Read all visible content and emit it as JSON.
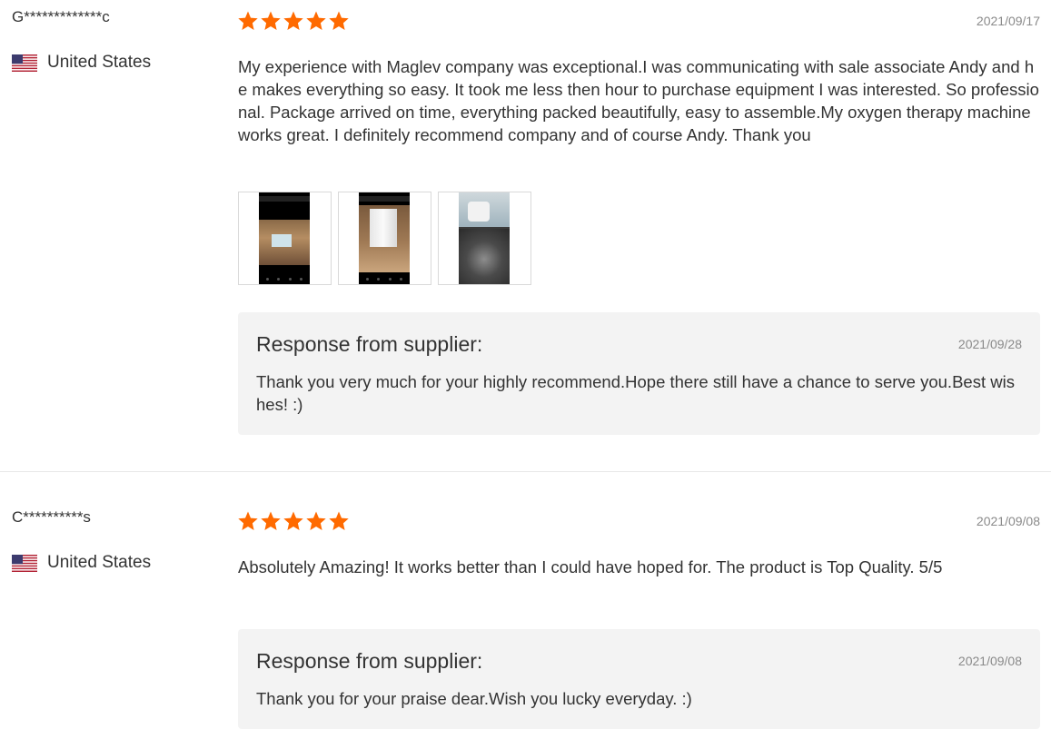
{
  "reviews": [
    {
      "name": "G*************c",
      "country": "United States",
      "flag_icon": "us-flag-icon",
      "rating": 5,
      "date": "2021/09/17",
      "content": "My experience with Maglev company was exceptional.I was communicating with sale associate Andy and he makes everything so easy. It took me less then hour to purchase equipment I was interested. So professional. Package arrived on time, everything packed beautifully, easy to assemble.My oxygen therapy machine works great. I definitely recommend company and of course Andy. Thank you",
      "photo_count": 3,
      "response": {
        "title": "Response from supplier:",
        "date": "2021/09/28",
        "text": "Thank you very much for your highly recommend.Hope there still have a chance to serve you.Best wishes! :)"
      }
    },
    {
      "name": "C**********s",
      "country": "United States",
      "flag_icon": "us-flag-icon",
      "rating": 5,
      "date": "2021/09/08",
      "content": "Absolutely Amazing! It works better than I could have hoped for. The product is Top Quality. 5/5",
      "response": {
        "title": "Response from supplier:",
        "date": "2021/09/08",
        "text": "Thank you for your praise dear.Wish you lucky everyday. :)"
      }
    }
  ],
  "colors": {
    "star": "#ff6a00",
    "response_bg": "#f3f3f3",
    "date": "#8a8a8a"
  }
}
